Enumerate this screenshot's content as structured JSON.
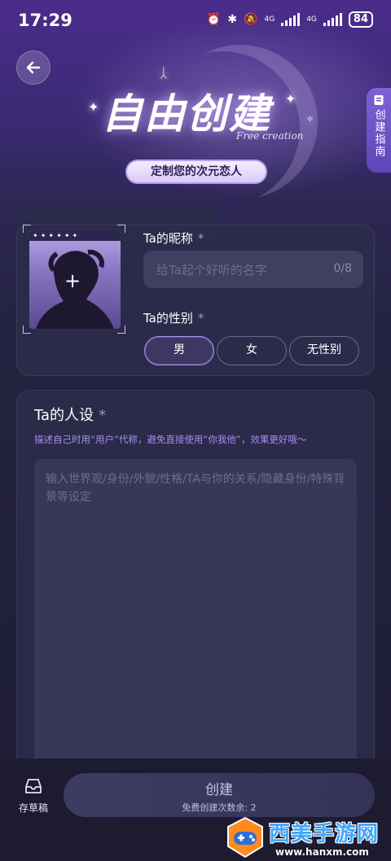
{
  "status_bar": {
    "time": "17:29",
    "battery": "84",
    "network_1": "4G",
    "network_2": "4G"
  },
  "header": {
    "title": "自由创建",
    "title_en": "Free creation",
    "tagline": "定制您的次元恋人",
    "guide_tab": "创建指南"
  },
  "profile": {
    "nickname_label": "Ta的昵称",
    "nickname_placeholder": "给Ta起个好听的名字",
    "nickname_count": "0/8",
    "gender_label": "Ta的性别",
    "gender_options": [
      "男",
      "女",
      "无性别"
    ],
    "gender_selected": "男",
    "required_mark": "*",
    "avatar_add": "+",
    "avatar_top_text": "✦✦✦✦✦✦"
  },
  "persona": {
    "title": "Ta的人设",
    "hint": "描述自己时用“用户”代称，避免直接使用“你我他”，效果更好哦～",
    "placeholder": "输入世界观/身份/外貌/性格/TA与你的关系/隐藏身份/特殊背景等设定"
  },
  "bottom": {
    "draft_label": "存草稿",
    "create_label": "创建",
    "create_sub": "免费创建次数余: 2"
  },
  "watermark": {
    "title": "西美手游网",
    "url": "www.hanxm.com"
  },
  "colors": {
    "accent": "#a996f2",
    "hint": "#a58ff2",
    "card": "#2d2b4b"
  }
}
